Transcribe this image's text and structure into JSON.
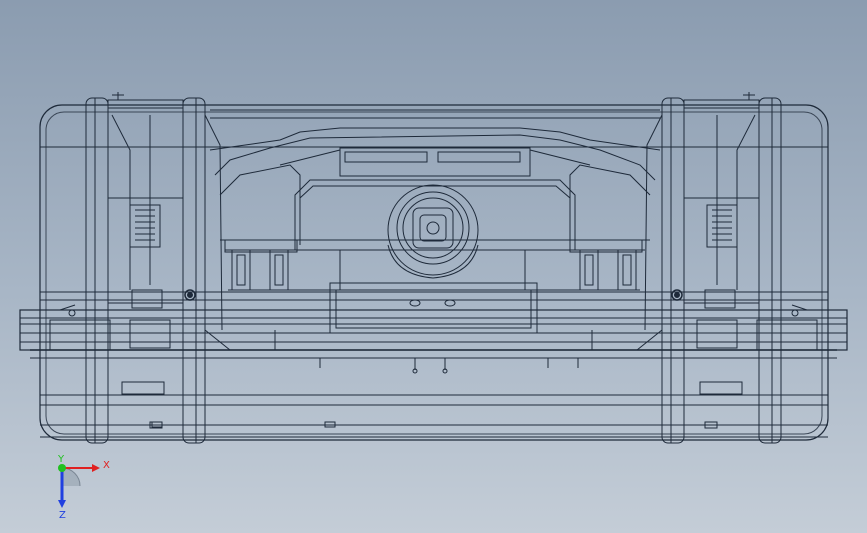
{
  "viewport": {
    "background_top": "#8b9cb0",
    "background_bottom": "#c4cdd7"
  },
  "model": {
    "line_color": "#1e2a3a",
    "light_line_color": "#4a5666"
  },
  "triad": {
    "x_label": "X",
    "y_label": "Y",
    "z_label": "Z",
    "x_color": "#e02020",
    "y_color": "#20c020",
    "z_color": "#2040e0"
  }
}
